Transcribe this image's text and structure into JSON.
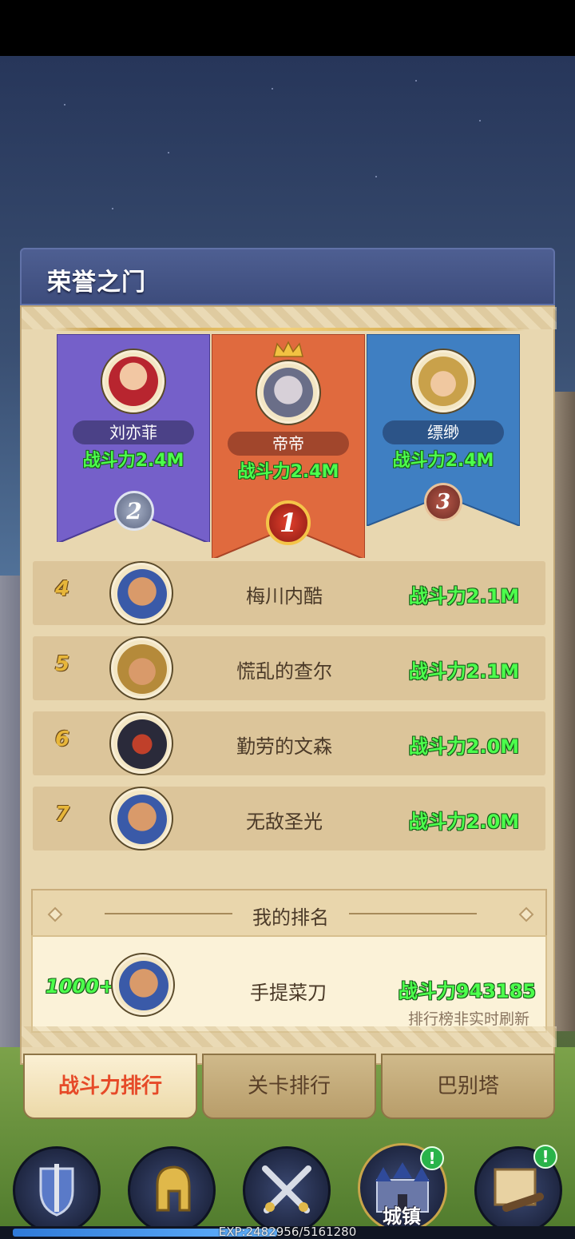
{
  "panel": {
    "title": "荣誉之门"
  },
  "top3": [
    {
      "rank": "2",
      "name": "刘亦菲",
      "power": "战斗力2.4M",
      "color": "#7560c9"
    },
    {
      "rank": "1",
      "name": "帝帝",
      "power": "战斗力2.4M",
      "color": "#e06a3e"
    },
    {
      "rank": "3",
      "name": "缥缈",
      "power": "战斗力2.4M",
      "color": "#3f7fc2"
    }
  ],
  "ranks": [
    {
      "rank": "4",
      "name": "梅川内酷",
      "power": "战斗力2.1M"
    },
    {
      "rank": "5",
      "name": "慌乱的查尔",
      "power": "战斗力2.1M"
    },
    {
      "rank": "6",
      "name": "勤劳的文森",
      "power": "战斗力2.0M"
    },
    {
      "rank": "7",
      "name": "无敌圣光",
      "power": "战斗力2.0M"
    }
  ],
  "my_rank": {
    "title": "我的排名",
    "rank": "1000+",
    "name": "手提菜刀",
    "power": "战斗力943185",
    "note": "排行榜非实时刷新"
  },
  "tabs": [
    {
      "label": "战斗力排行",
      "active": true
    },
    {
      "label": "关卡排行",
      "active": false
    },
    {
      "label": "巴别塔",
      "active": false
    }
  ],
  "bottom_nav": {
    "items": [
      {
        "icon": "shield-sword-icon"
      },
      {
        "icon": "spartan-helmet-icon"
      },
      {
        "icon": "crossed-swords-icon"
      },
      {
        "icon": "castle-icon",
        "label": "城镇",
        "badge": "!"
      },
      {
        "icon": "map-spyglass-icon",
        "badge": "!"
      }
    ]
  },
  "exp": {
    "text": "EXP:2482956/5161280",
    "fraction": 0.481
  }
}
